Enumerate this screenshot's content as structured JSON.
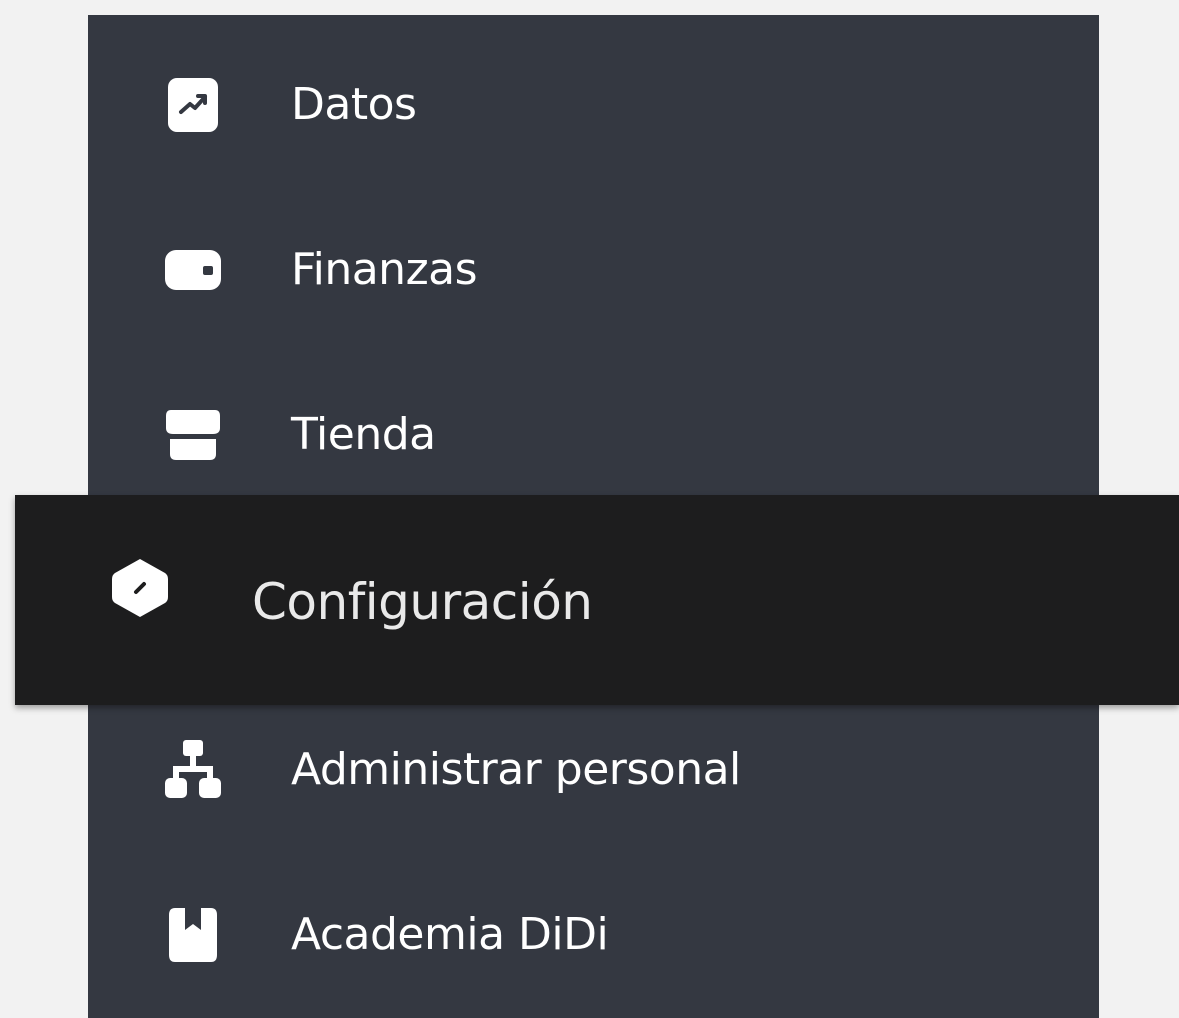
{
  "sidebar": {
    "items": [
      {
        "label": "Datos",
        "icon": "chart-trend-icon"
      },
      {
        "label": "Finanzas",
        "icon": "wallet-icon"
      },
      {
        "label": "Tienda",
        "icon": "store-icon"
      },
      {
        "label": "Configuración",
        "icon": "settings-hexagon-icon",
        "state": "active"
      },
      {
        "label": "Administrar personal",
        "icon": "org-chart-icon"
      },
      {
        "label": "Academia DiDi",
        "icon": "book-icon"
      }
    ]
  },
  "colors": {
    "page_background": "#f2f2f2",
    "sidebar_background": "#343841",
    "active_background": "#1d1d1e",
    "text": "#ffffff"
  }
}
